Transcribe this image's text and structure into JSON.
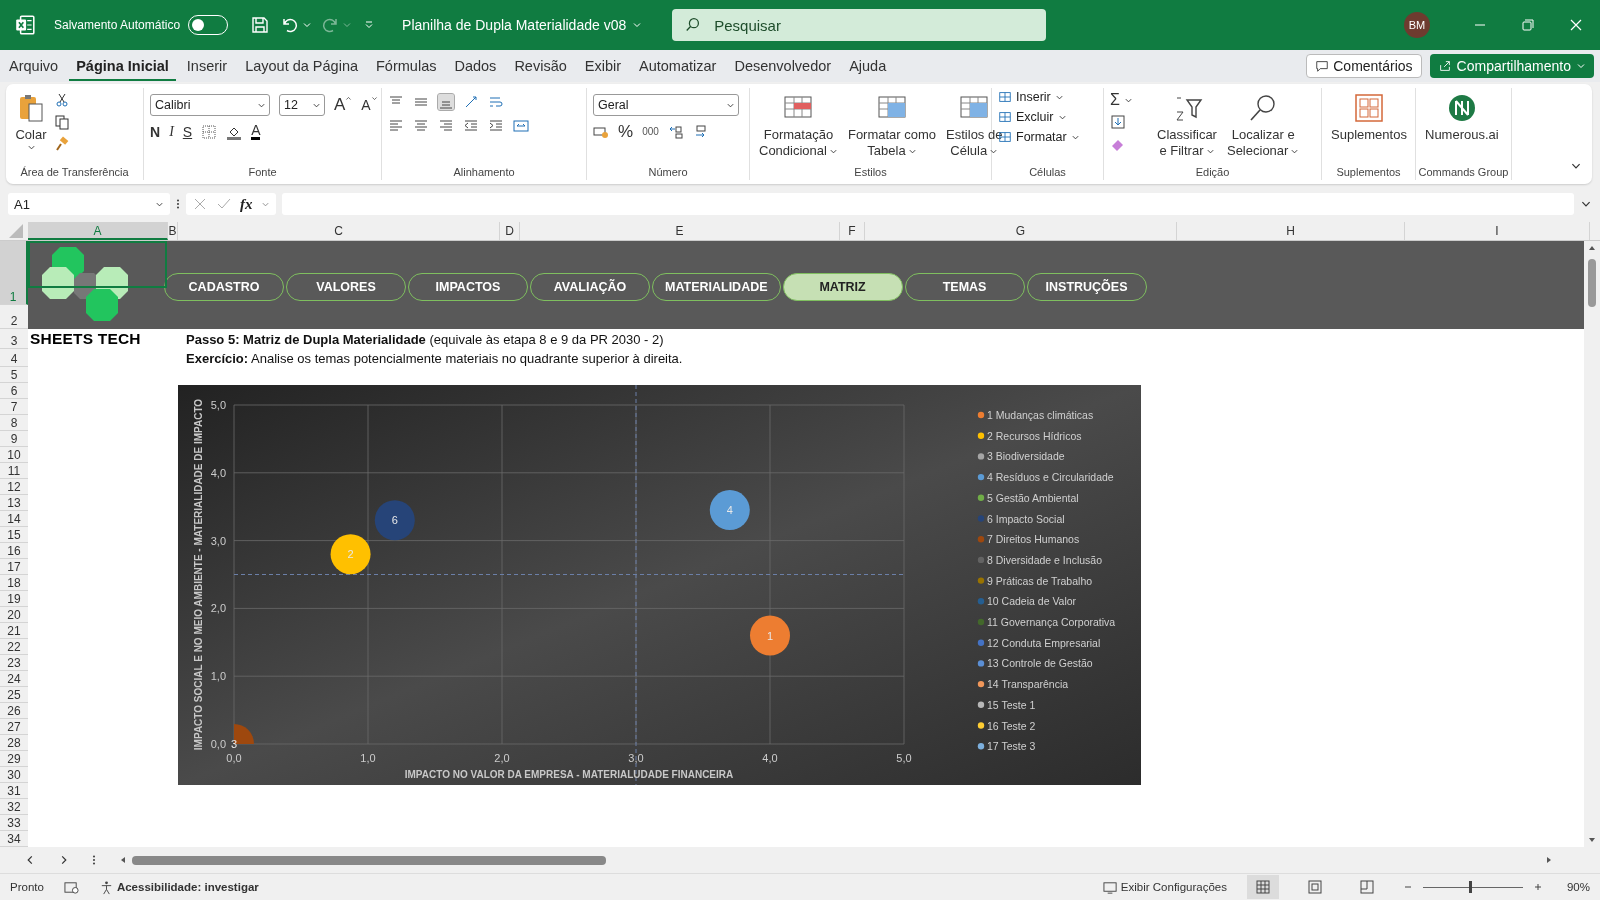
{
  "title_bar": {
    "autosave_label": "Salvamento Automático",
    "autosave_on": false,
    "redo_disabled": true,
    "document_title": "Planilha de Dupla Materialidade v08",
    "search": {
      "placeholder": "Pesquisar"
    },
    "avatar": "BM"
  },
  "menu": {
    "tabs": [
      {
        "label": "Arquivo",
        "selected": false
      },
      {
        "label": "Página Inicial",
        "selected": true
      },
      {
        "label": "Inserir",
        "selected": false
      },
      {
        "label": "Layout da Página",
        "selected": false
      },
      {
        "label": "Fórmulas",
        "selected": false
      },
      {
        "label": "Dados",
        "selected": false
      },
      {
        "label": "Revisão",
        "selected": false
      },
      {
        "label": "Exibir",
        "selected": false
      },
      {
        "label": "Automatizar",
        "selected": false
      },
      {
        "label": "Desenvolvedor",
        "selected": false
      },
      {
        "label": "Ajuda",
        "selected": false
      }
    ],
    "comments_button": "Comentários",
    "share_button": "Compartilhamento"
  },
  "ribbon": {
    "clipboard": {
      "paste": "Colar",
      "group": "Área de Transferência"
    },
    "font": {
      "family": "Calibri",
      "size": "12",
      "grow": "A",
      "shrink": "A",
      "bold": "N",
      "italic": "I",
      "underline": "S",
      "font_color": "A",
      "group": "Fonte"
    },
    "alignment": {
      "bottom_align_selected": true,
      "group": "Alinhamento"
    },
    "number": {
      "format": "Geral",
      "percent": "%",
      "thousands": "000",
      "group": "Número"
    },
    "styles": {
      "buttons": [
        [
          "Formatação",
          "Condicional"
        ],
        [
          "Formatar como",
          "Tabela"
        ],
        [
          "Estilos de",
          "Célula"
        ]
      ],
      "group": "Estilos"
    },
    "cells": {
      "buttons": [
        "Inserir",
        "Excluir",
        "Formatar"
      ],
      "group": "Células"
    },
    "editing": {
      "autosum": "Σ",
      "sort": [
        "Classificar",
        "e Filtrar"
      ],
      "find": [
        "Localizar e",
        "Selecionar"
      ],
      "group": "Edição"
    },
    "addins": {
      "button": "Suplementos",
      "group": "Suplementos"
    },
    "commands": {
      "button": "Numerous.ai",
      "group": "Commands Group"
    }
  },
  "formula_bar": {
    "name_box": "A1",
    "fx": "fx"
  },
  "sheet": {
    "columns": [
      {
        "label": "A",
        "selected": true
      },
      {
        "label": "B",
        "selected": false
      },
      {
        "label": "C",
        "selected": false
      },
      {
        "label": "D",
        "selected": false
      },
      {
        "label": "E",
        "selected": false
      },
      {
        "label": "F",
        "selected": false
      },
      {
        "label": "G",
        "selected": false
      },
      {
        "label": "H",
        "selected": false
      },
      {
        "label": "I",
        "selected": false
      }
    ],
    "rows": [
      {
        "label": "1",
        "selected": true
      },
      {
        "label": "2",
        "selected": false
      },
      {
        "label": "3",
        "selected": false
      },
      {
        "label": "4",
        "selected": false
      },
      {
        "label": "5",
        "selected": false
      },
      {
        "label": "6",
        "selected": false
      },
      {
        "label": "7",
        "selected": false
      },
      {
        "label": "8",
        "selected": false
      },
      {
        "label": "9",
        "selected": false
      },
      {
        "label": "10",
        "selected": false
      },
      {
        "label": "11",
        "selected": false
      },
      {
        "label": "12",
        "selected": false
      },
      {
        "label": "13",
        "selected": false
      },
      {
        "label": "14",
        "selected": false
      },
      {
        "label": "15",
        "selected": false
      },
      {
        "label": "16",
        "selected": false
      },
      {
        "label": "17",
        "selected": false
      },
      {
        "label": "18",
        "selected": false
      },
      {
        "label": "19",
        "selected": false
      },
      {
        "label": "20",
        "selected": false
      },
      {
        "label": "21",
        "selected": false
      },
      {
        "label": "22",
        "selected": false
      },
      {
        "label": "23",
        "selected": false
      },
      {
        "label": "24",
        "selected": false
      },
      {
        "label": "25",
        "selected": false
      },
      {
        "label": "26",
        "selected": false
      },
      {
        "label": "27",
        "selected": false
      },
      {
        "label": "28",
        "selected": false
      },
      {
        "label": "29",
        "selected": false
      },
      {
        "label": "30",
        "selected": false
      },
      {
        "label": "31",
        "selected": false
      },
      {
        "label": "32",
        "selected": false
      },
      {
        "label": "33",
        "selected": false
      },
      {
        "label": "34",
        "selected": false
      }
    ],
    "nav_buttons": [
      {
        "label": "CADASTRO",
        "selected": false
      },
      {
        "label": "VALORES",
        "selected": false
      },
      {
        "label": "IMPACTOS",
        "selected": false
      },
      {
        "label": "AVALIAÇÃO",
        "selected": false
      },
      {
        "label": "MATERIALIDADE",
        "selected": false
      },
      {
        "label": "MATRIZ",
        "selected": true
      },
      {
        "label": "TEMAS",
        "selected": false
      },
      {
        "label": "INSTRUÇÕES",
        "selected": false
      }
    ],
    "brand": "SHEETS TECH",
    "step_text": "**Passo 5: Matriz de Dupla Materialidade** (equivale às etapa 8 e 9 da PR 2030 - 2)",
    "exercise_text": "**Exercício:** Analise os temas potencialmente materiais no quadrante superior à direita."
  },
  "chart": {
    "chart_data": {
      "type": "scatter",
      "xlabel": "IMPACTO NO VALOR DA EMPRESA - MATERIALUDADE FINANCEIRA",
      "ylabel": "IMPACTO SOCIAL E NO MEIO AMBIENTE - MATERIALIDADE DE IMPACTO",
      "xlim": [
        0,
        5
      ],
      "ylim": [
        0,
        5
      ],
      "grid": true,
      "legend": "right",
      "xticks": [
        {
          "value": 0,
          "label": "0,0"
        },
        {
          "value": 1,
          "label": "1,0"
        },
        {
          "value": 2,
          "label": "2,0"
        },
        {
          "value": 3,
          "label": "3,0"
        },
        {
          "value": 4,
          "label": "4,0"
        },
        {
          "value": 5,
          "label": "5,0"
        }
      ],
      "yticks": [
        {
          "value": 0,
          "label": "0,0"
        },
        {
          "value": 1,
          "label": "1,0"
        },
        {
          "value": 2,
          "label": "2,0"
        },
        {
          "value": 3,
          "label": "3,0"
        },
        {
          "value": 4,
          "label": "4,0"
        },
        {
          "value": 5,
          "label": "5,0"
        }
      ],
      "series": [
        {
          "name": "1 Mudanças climáticas",
          "color": "#ed7d31",
          "x": [
            4.0
          ],
          "values": [
            1.6
          ]
        },
        {
          "name": "2 Recursos Hídricos",
          "color": "#ffc000",
          "x": [
            0.87
          ],
          "values": [
            2.8
          ]
        },
        {
          "name": "3 Biodiversidade",
          "color": "#a5a5a5",
          "x": [
            null
          ],
          "values": [
            null
          ]
        },
        {
          "name": "4 Resíduos e Circularidade",
          "color": "#5b9bd5",
          "x": [
            3.7
          ],
          "values": [
            3.45
          ]
        },
        {
          "name": "5 Gestão Ambiental",
          "color": "#70ad47",
          "x": [
            null
          ],
          "values": [
            null
          ]
        },
        {
          "name": "6 Impacto Social",
          "color": "#264478",
          "x": [
            1.2
          ],
          "values": [
            3.3
          ]
        },
        {
          "name": "7 Direitos Humanos",
          "color": "#9e480e",
          "x": [
            0
          ],
          "values": [
            0
          ]
        },
        {
          "name": "8 Diversidade e Inclusão",
          "color": "#636363",
          "x": [
            null
          ],
          "values": [
            null
          ]
        },
        {
          "name": "9 Práticas de Trabalho",
          "color": "#997300",
          "x": [
            null
          ],
          "values": [
            null
          ]
        },
        {
          "name": "10 Cadeia de Valor",
          "color": "#255e91",
          "x": [
            null
          ],
          "values": [
            null
          ]
        },
        {
          "name": "11 Governança Corporativa",
          "color": "#43682b",
          "x": [
            null
          ],
          "values": [
            null
          ]
        },
        {
          "name": "12 Conduta Empresarial",
          "color": "#4472c4",
          "x": [
            null
          ],
          "values": [
            null
          ]
        },
        {
          "name": "13 Controle de Gestão",
          "color": "#5b8fd5",
          "x": [
            null
          ],
          "values": [
            null
          ]
        },
        {
          "name": "14 Transparência",
          "color": "#f1975a",
          "x": [
            null
          ],
          "values": [
            null
          ]
        },
        {
          "name": "15 Teste 1",
          "color": "#b7b7b7",
          "x": [
            null
          ],
          "values": [
            null
          ]
        },
        {
          "name": "16 Teste 2",
          "color": "#ffcd33",
          "x": [
            null
          ],
          "values": [
            null
          ]
        },
        {
          "name": "17 Teste 3",
          "color": "#7cafdd",
          "x": [
            null
          ],
          "values": [
            null
          ]
        }
      ],
      "ref_lines": [
        {
          "axis": "x",
          "value": 3
        },
        {
          "axis": "y",
          "value": 2.5
        }
      ],
      "annotations": [
        {
          "x": 4.0,
          "y": 1.6,
          "text": "1"
        },
        {
          "x": 0.87,
          "y": 2.8,
          "text": "2"
        },
        {
          "x": 0,
          "y": 0,
          "text": "3"
        },
        {
          "x": 3.7,
          "y": 3.45,
          "text": "4"
        },
        {
          "x": 1.2,
          "y": 3.3,
          "text": "6"
        }
      ]
    }
  },
  "status_bar": {
    "ready": "Pronto",
    "accessibility": "Acessibilidade: investigar",
    "display_settings": "Exibir Configurações",
    "zoom": "90%",
    "zoom_slider": {
      "level": 0.46
    }
  }
}
